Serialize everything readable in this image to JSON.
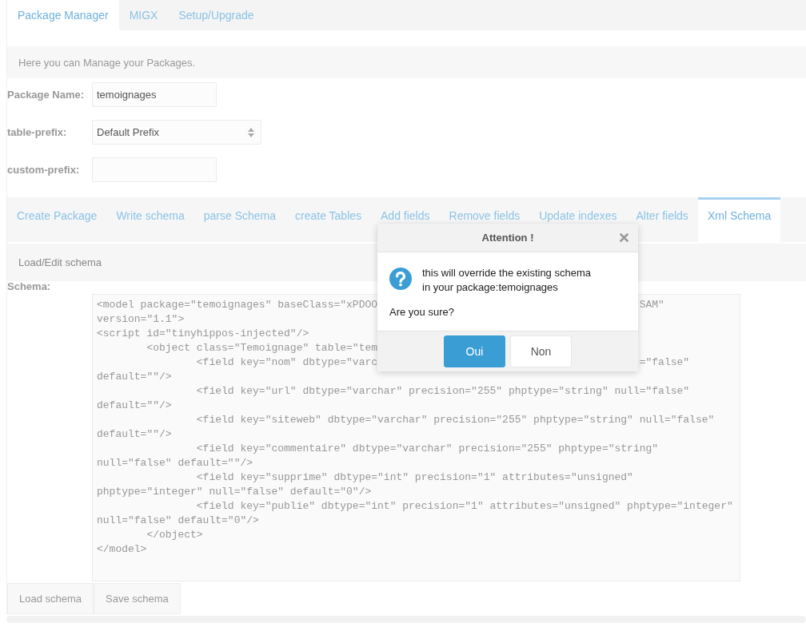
{
  "top_tabs": [
    {
      "label": "Package Manager",
      "selected": true
    },
    {
      "label": "MIGX",
      "selected": false
    },
    {
      "label": "Setup/Upgrade",
      "selected": false
    }
  ],
  "description": "Here you can Manage your Packages.",
  "form": [
    {
      "kind": "text",
      "label": "Package Name:",
      "value": "temoignages"
    },
    {
      "kind": "select",
      "label": "table-prefix:",
      "value": "Default Prefix"
    },
    {
      "kind": "text",
      "label": "custom-prefix:"
    }
  ],
  "sub_tabs": [
    {
      "label": "Create Package",
      "selected": false
    },
    {
      "label": "Write schema",
      "selected": false
    },
    {
      "label": "parse Schema",
      "selected": false
    },
    {
      "label": "create Tables",
      "selected": false
    },
    {
      "label": "Add fields",
      "selected": false
    },
    {
      "label": "Remove fields",
      "selected": false
    },
    {
      "label": "Update indexes",
      "selected": false
    },
    {
      "label": "Alter fields",
      "selected": false
    },
    {
      "label": "Xml Schema",
      "selected": true
    }
  ],
  "section_heading": "Load/Edit schema",
  "schema": {
    "label": "Schema:",
    "lines": [
      {
        "text": "<model package=\"temoignages\" baseClass=\"xPDOO",
        "text_right": "SAM\""
      },
      {
        "text": "version=\"1.1\">"
      },
      {
        "text": "<script id=\"tinyhippos-injected\"/>"
      },
      {
        "text": "        <object class=\"Temoignage\" table=\"tem"
      },
      {
        "text": "                <field key=\"nom\" dbtype=\"varc",
        "text_right": "=\"false\""
      },
      {
        "text": "default=\"\"/>"
      },
      {
        "text": "                <field key=\"url\" dbtype=\"varchar\" precision=\"255\" phptype=\"string\" null=\"false\""
      },
      {
        "text": "default=\"\"/>"
      },
      {
        "text": "                <field key=\"siteweb\" dbtype=\"varchar\" precision=\"255\" phptype=\"string\" null=\"false\""
      },
      {
        "text": "default=\"\"/>"
      },
      {
        "text": "                <field key=\"commentaire\" dbtype=\"varchar\" precision=\"255\" phptype=\"string\""
      },
      {
        "text": "null=\"false\" default=\"\"/>"
      },
      {
        "text": "                <field key=\"supprime\" dbtype=\"int\" precision=\"1\" attributes=\"unsigned\""
      },
      {
        "text": "phptype=\"integer\" null=\"false\" default=\"0\"/>"
      },
      {
        "text": "                <field key=\"publie\" dbtype=\"int\" precision=\"1\" attributes=\"unsigned\" phptype=\"integer\""
      },
      {
        "text": "null=\"false\" default=\"0\"/>"
      },
      {
        "text": "        </object>"
      },
      {
        "text": "</model>"
      }
    ]
  },
  "buttons": [
    "Load schema",
    "Save schema"
  ],
  "dialog": {
    "title": "Attention !",
    "message": [
      "this will override the existing schema",
      "in your package:temoignages"
    ],
    "question": "Are you sure?",
    "buttons": [
      {
        "label": "Oui",
        "kind": "primary"
      },
      {
        "label": "Non",
        "kind": "default"
      }
    ]
  }
}
